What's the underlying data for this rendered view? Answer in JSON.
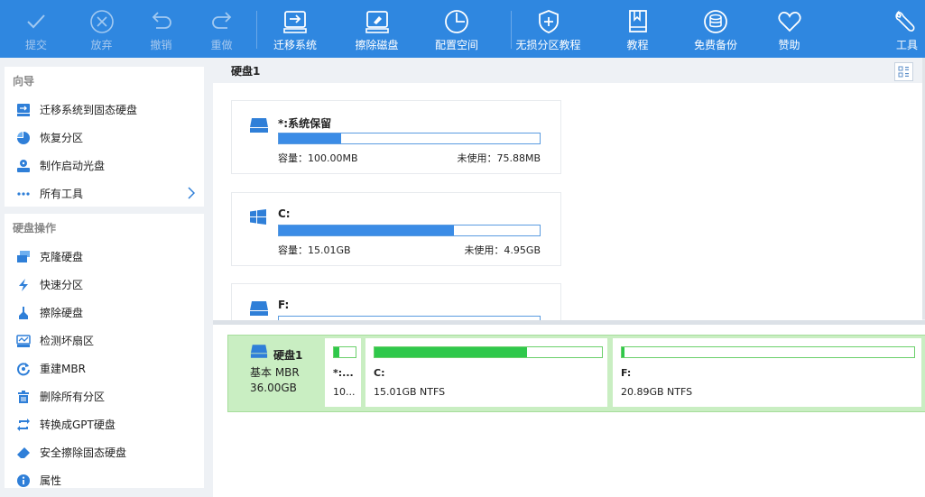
{
  "toolbar": {
    "submit": "提交",
    "discard": "放弃",
    "undo": "撤销",
    "redo": "重做",
    "migrate": "迁移系统",
    "wipe": "擦除磁盘",
    "alloc": "配置空间",
    "lossless": "无损分区教程",
    "tutorial": "教程",
    "backup": "免费备份",
    "donate": "赞助",
    "tools": "工具"
  },
  "sidebar": {
    "wizard_title": "向导",
    "wizard_items": [
      {
        "label": "迁移系统到固态硬盘",
        "icon": "migrate-ssd-icon"
      },
      {
        "label": "恢复分区",
        "icon": "recover-partition-icon"
      },
      {
        "label": "制作启动光盘",
        "icon": "boot-disc-icon"
      },
      {
        "label": "所有工具",
        "icon": "more-tools-icon"
      }
    ],
    "disk_ops_title": "硬盘操作",
    "disk_ops_items": [
      {
        "label": "克隆硬盘",
        "icon": "clone-disk-icon"
      },
      {
        "label": "快速分区",
        "icon": "quick-partition-icon"
      },
      {
        "label": "擦除硬盘",
        "icon": "wipe-disk-icon"
      },
      {
        "label": "检测坏扇区",
        "icon": "bad-sector-icon"
      },
      {
        "label": "重建MBR",
        "icon": "rebuild-mbr-icon"
      },
      {
        "label": "删除所有分区",
        "icon": "delete-partitions-icon"
      },
      {
        "label": "转换成GPT硬盘",
        "icon": "convert-gpt-icon"
      },
      {
        "label": "安全擦除固态硬盘",
        "icon": "secure-erase-ssd-icon"
      },
      {
        "label": "属性",
        "icon": "properties-icon"
      }
    ]
  },
  "main": {
    "disk_title": "硬盘1",
    "partitions": [
      {
        "name": "*:系统保留",
        "usage": 0.24,
        "capacity": "容量：100.00MB",
        "unused": "未使用：75.88MB",
        "icon": "drive-icon"
      },
      {
        "name": "C:",
        "usage": 0.67,
        "capacity": "容量：15.01GB",
        "unused": "未使用：4.95GB",
        "icon": "windows-icon"
      },
      {
        "name": "F:",
        "usage": 0.0,
        "capacity": "",
        "unused": "",
        "icon": "drive-icon"
      }
    ]
  },
  "diskmap": {
    "name": "硬盘1",
    "type": "基本 MBR",
    "size": "36.00GB",
    "blocks": [
      {
        "name": "*:...",
        "info": "10...",
        "usage": 0.24
      },
      {
        "name": "C:",
        "info": "15.01GB NTFS",
        "usage": 0.67
      },
      {
        "name": "F:",
        "info": "20.89GB NTFS",
        "usage": 0.01
      }
    ]
  },
  "colors": {
    "toolbar": "#2f87e0",
    "used_blue": "#3b8ce6",
    "used_green": "#2fc84b",
    "disk_row_bg": "#c9eec2"
  }
}
